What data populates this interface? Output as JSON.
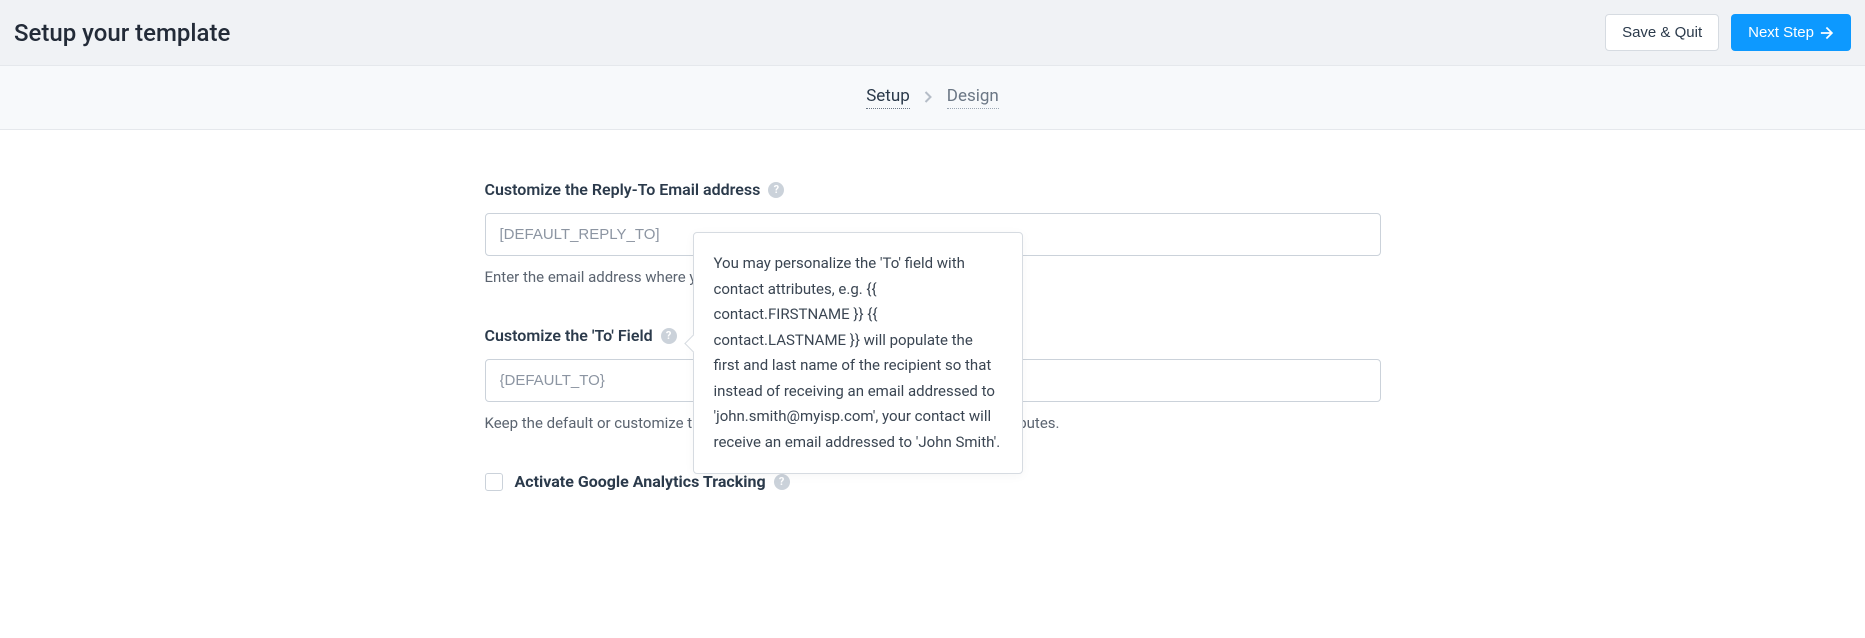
{
  "header": {
    "title": "Setup your template",
    "save_quit_label": "Save & Quit",
    "next_step_label": "Next Step"
  },
  "breadcrumb": {
    "step1": "Setup",
    "step2": "Design"
  },
  "reply_to": {
    "label": "Customize the Reply-To Email address",
    "placeholder": "[DEFAULT_REPLY_TO]",
    "helper": "Enter the email address where you want to receive replies from your contacts."
  },
  "to_field": {
    "label": "Customize the 'To' Field",
    "placeholder": "{DEFAULT_TO}",
    "helper": "Keep the default or customize the 'to' field of your email header with contact attributes."
  },
  "tooltip_text": "You may personalize the 'To' field with contact attributes, e.g. {{ contact.FIRSTNAME }} {{ contact.LASTNAME }} will populate the first and last name of the recipient so that instead of receiving an email addressed to 'john.smith@myisp.com', your contact will receive an email addressed to 'John Smith'.",
  "ga_tracking": {
    "label": "Activate Google Analytics Tracking"
  }
}
